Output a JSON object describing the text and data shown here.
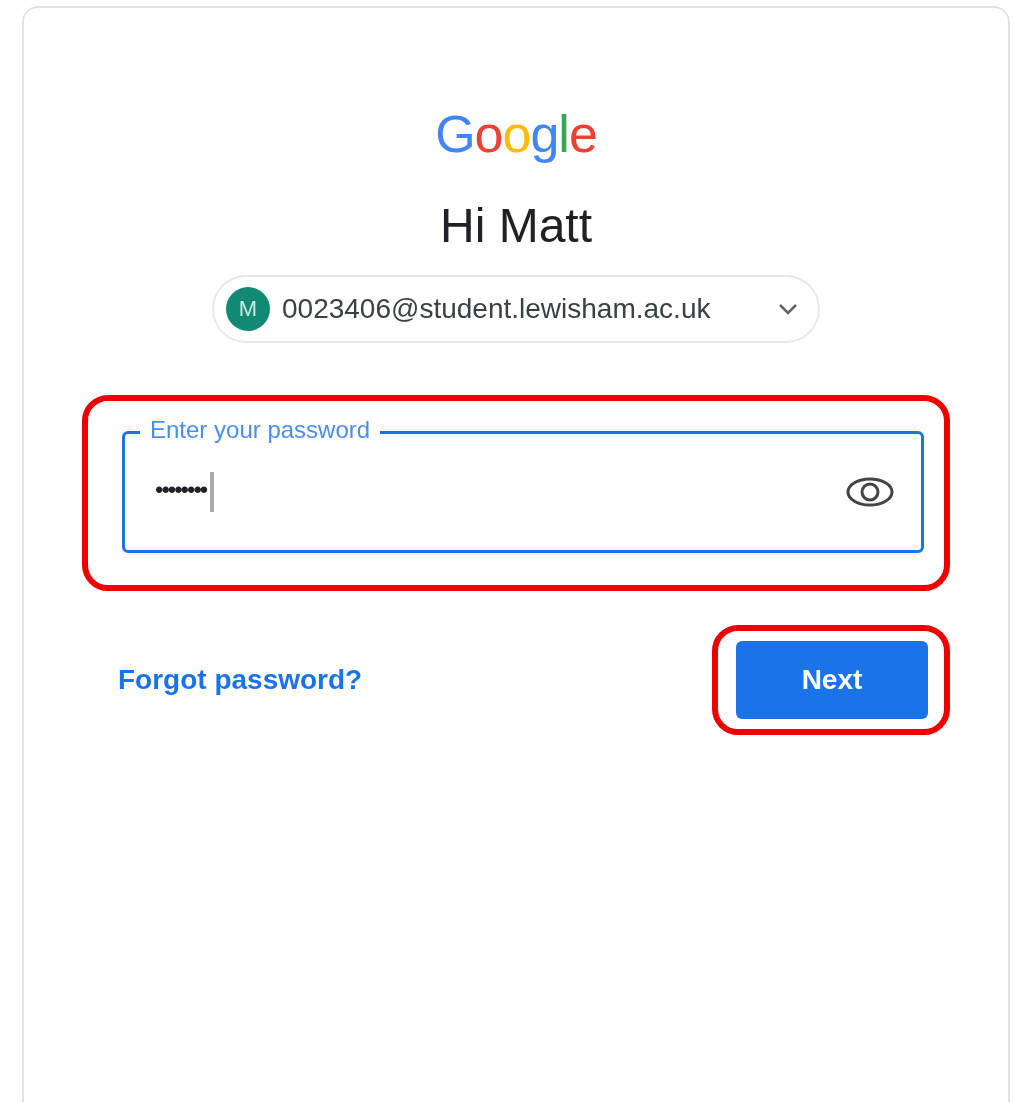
{
  "logo": "Google",
  "heading": "Hi Matt",
  "account": {
    "avatar_letter": "M",
    "email": "0023406@student.lewisham.ac.uk"
  },
  "password_field": {
    "label": "Enter your password",
    "value": "••••••••",
    "focused": true,
    "highlighted": true
  },
  "forgot_link": "Forgot password?",
  "next_button": {
    "label": "Next",
    "highlighted": true
  }
}
